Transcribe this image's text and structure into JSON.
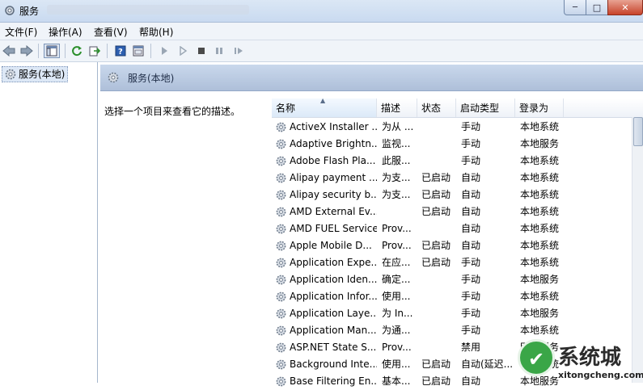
{
  "window": {
    "title": "服务",
    "controls": {
      "minimize": "─",
      "maximize": "□",
      "close": "✕"
    }
  },
  "menu": [
    "文件(F)",
    "操作(A)",
    "查看(V)",
    "帮助(H)"
  ],
  "toolbar": [
    "back-arrow-icon",
    "forward-arrow-icon",
    "show-tree-icon",
    "refresh-icon",
    "export-icon",
    "help-icon",
    "properties-icon",
    "start-service-icon",
    "start-service-alt-icon",
    "stop-service-icon",
    "pause-service-icon",
    "resume-service-icon"
  ],
  "tree": {
    "node_label": "服务(本地)"
  },
  "pane": {
    "title": "服务(本地)",
    "description_prompt": "选择一个项目来查看它的描述。"
  },
  "columns": {
    "name": "名称",
    "desc": "描述",
    "status": "状态",
    "startup": "启动类型",
    "logon": "登录为"
  },
  "services": [
    {
      "name": "ActiveX Installer ...",
      "desc": "为从 ...",
      "status": "",
      "startup": "手动",
      "logon": "本地系统"
    },
    {
      "name": "Adaptive Brightn...",
      "desc": "监视...",
      "status": "",
      "startup": "手动",
      "logon": "本地服务"
    },
    {
      "name": "Adobe Flash Pla...",
      "desc": "此服...",
      "status": "",
      "startup": "手动",
      "logon": "本地系统"
    },
    {
      "name": "Alipay payment ...",
      "desc": "为支...",
      "status": "已启动",
      "startup": "自动",
      "logon": "本地系统"
    },
    {
      "name": "Alipay security b...",
      "desc": "为支...",
      "status": "已启动",
      "startup": "自动",
      "logon": "本地系统"
    },
    {
      "name": "AMD External Ev...",
      "desc": "",
      "status": "已启动",
      "startup": "自动",
      "logon": "本地系统"
    },
    {
      "name": "AMD FUEL Service",
      "desc": "Prov...",
      "status": "",
      "startup": "自动",
      "logon": "本地系统"
    },
    {
      "name": "Apple Mobile D...",
      "desc": "Prov...",
      "status": "已启动",
      "startup": "自动",
      "logon": "本地系统"
    },
    {
      "name": "Application Expe...",
      "desc": "在应...",
      "status": "已启动",
      "startup": "手动",
      "logon": "本地系统"
    },
    {
      "name": "Application Iden...",
      "desc": "确定...",
      "status": "",
      "startup": "手动",
      "logon": "本地服务"
    },
    {
      "name": "Application Infor...",
      "desc": "使用...",
      "status": "",
      "startup": "手动",
      "logon": "本地系统"
    },
    {
      "name": "Application Laye...",
      "desc": "为 In...",
      "status": "",
      "startup": "手动",
      "logon": "本地服务"
    },
    {
      "name": "Application Man...",
      "desc": "为通...",
      "status": "",
      "startup": "手动",
      "logon": "本地系统"
    },
    {
      "name": "ASP.NET State S...",
      "desc": "Prov...",
      "status": "",
      "startup": "禁用",
      "logon": "网络服务"
    },
    {
      "name": "Background Inte...",
      "desc": "使用...",
      "status": "已启动",
      "startup": "自动(延迟...",
      "logon": "本地系统"
    },
    {
      "name": "Base Filtering En...",
      "desc": "基本...",
      "status": "已启动",
      "startup": "自动",
      "logon": "本地服务"
    }
  ],
  "watermark": {
    "logo_char": "",
    "text": "系统城",
    "url": "xitongcheng.com"
  }
}
